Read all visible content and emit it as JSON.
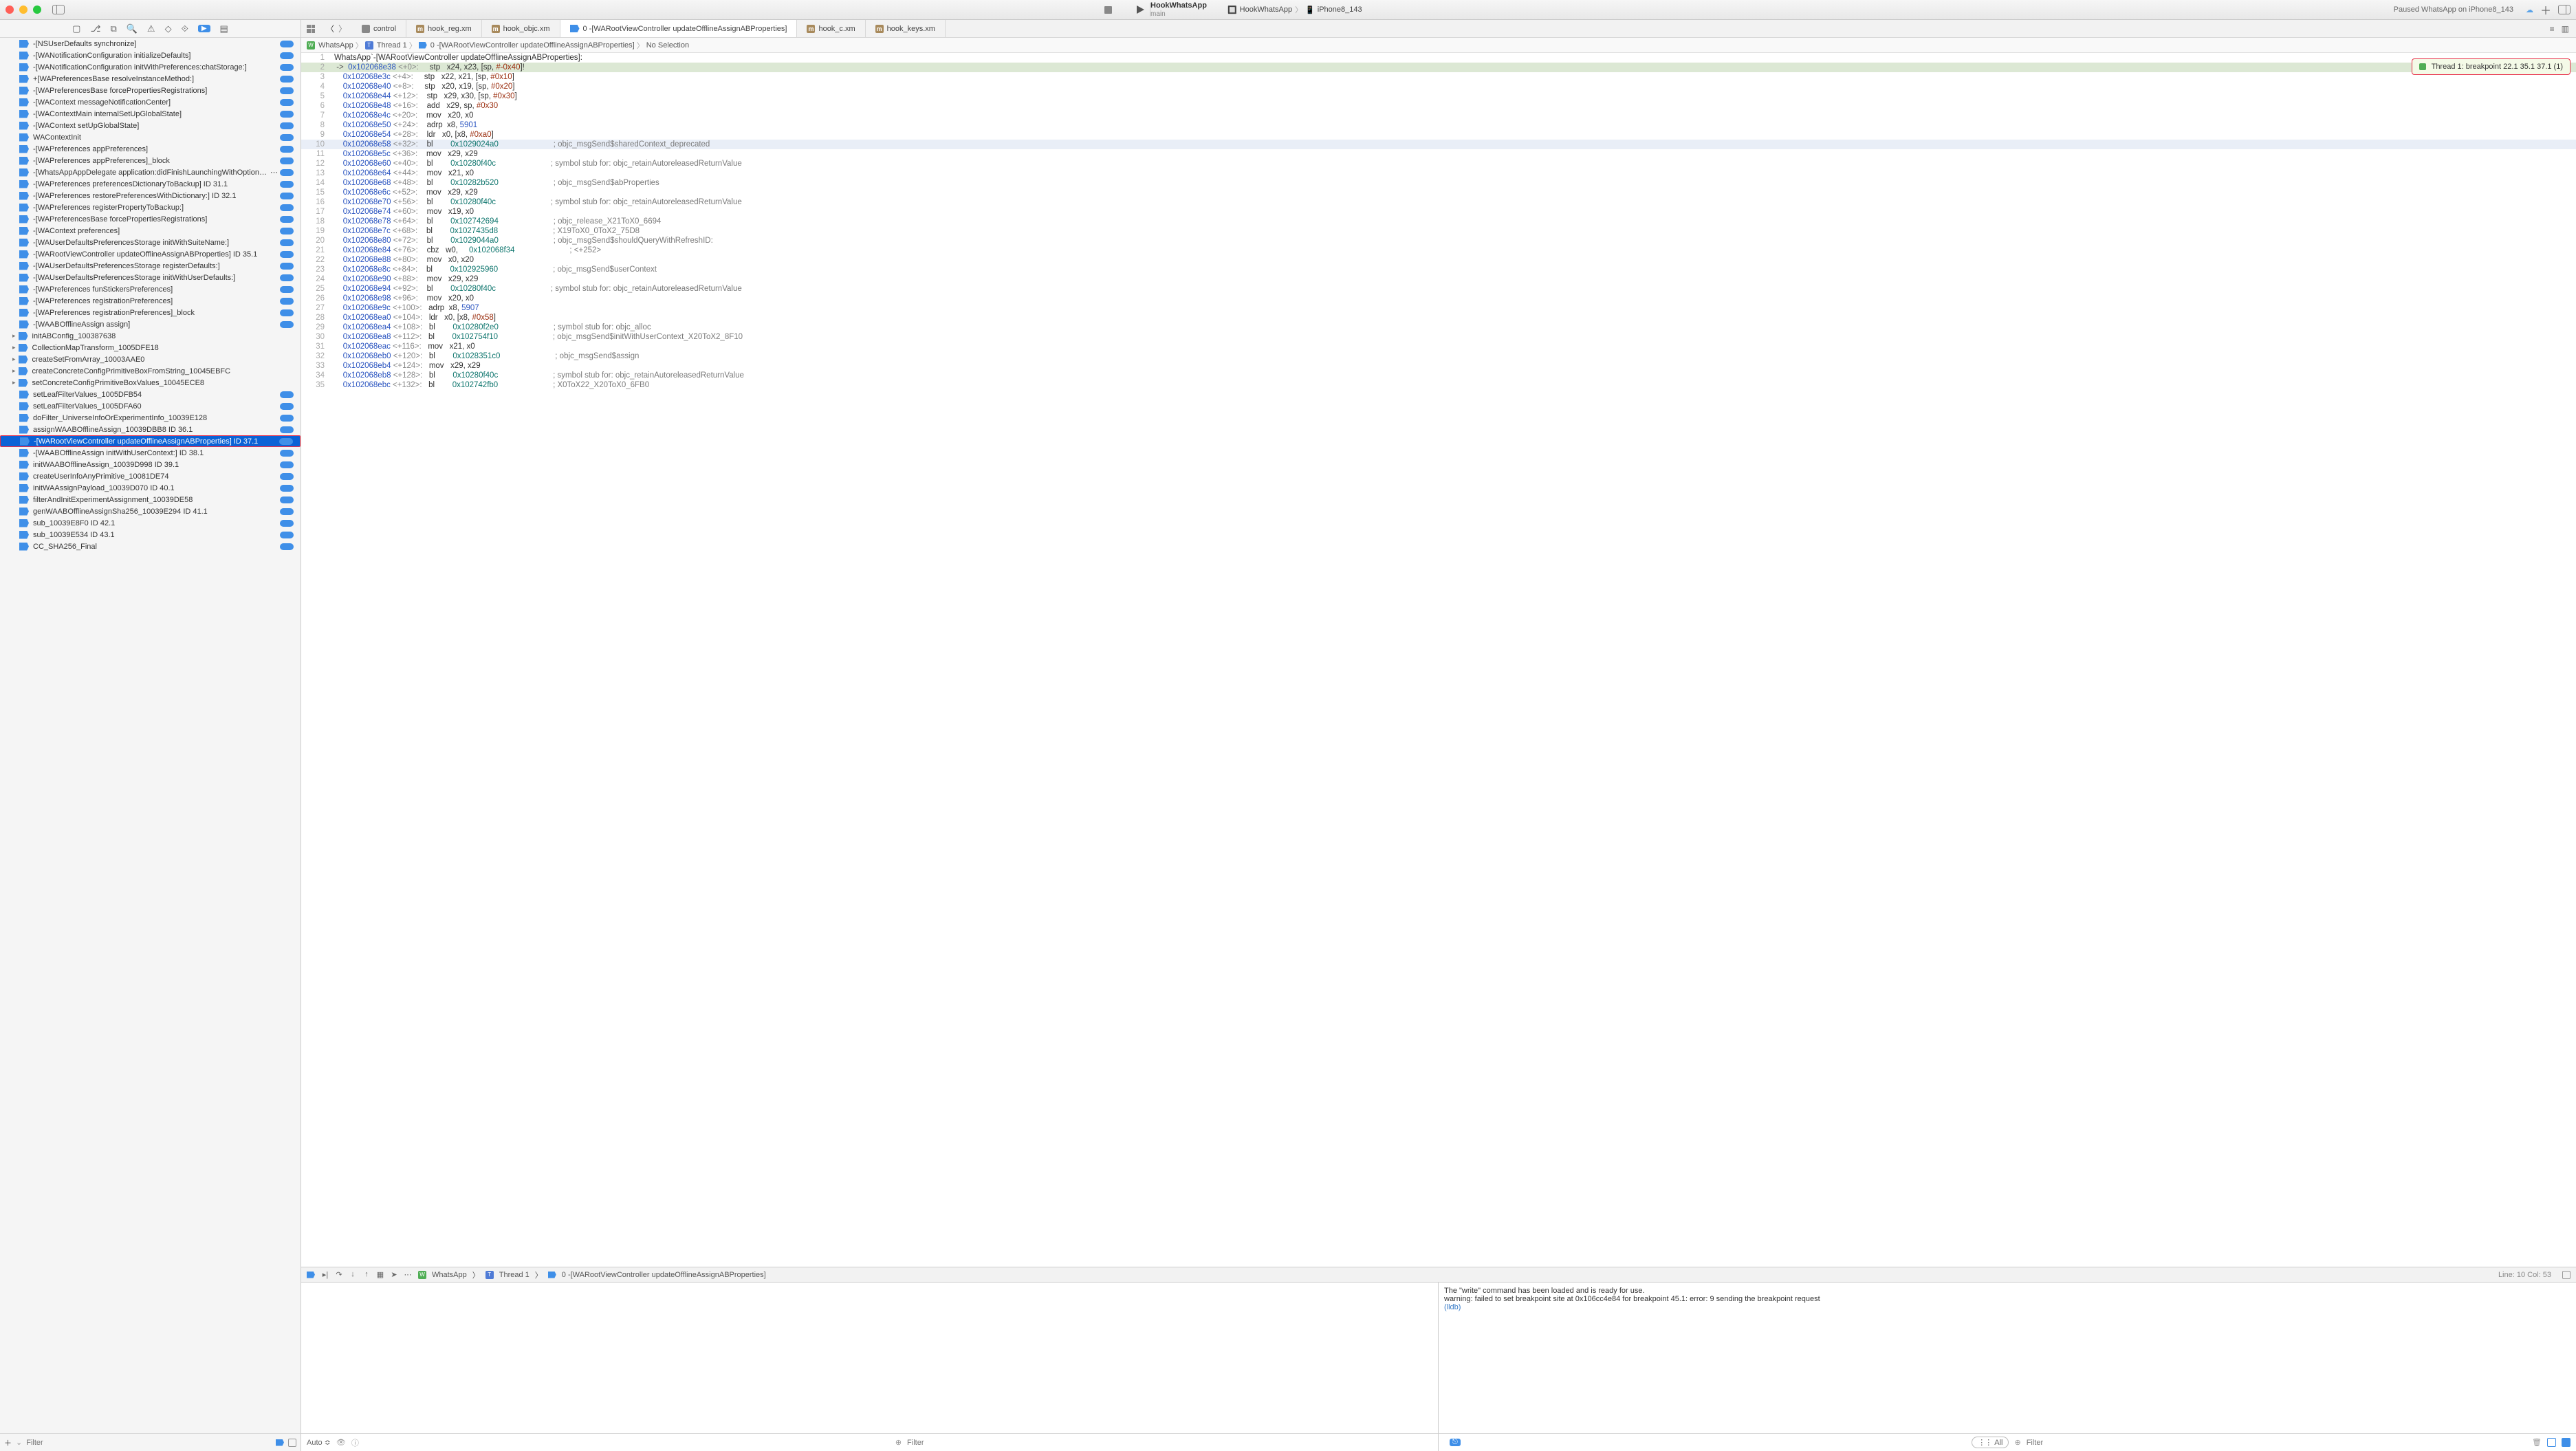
{
  "titlebar": {
    "project": "HookWhatsApp",
    "branch": "main",
    "crumb_app": "HookWhatsApp",
    "crumb_device": "iPhone8_143",
    "status": "Paused WhatsApp on iPhone8_143"
  },
  "nav": {
    "tabs": [
      {
        "icon": "a",
        "label": "control"
      },
      {
        "icon": "m",
        "label": "hook_reg.xm"
      },
      {
        "icon": "m",
        "label": "hook_objc.xm"
      },
      {
        "icon": "bp",
        "label": "0 -[WARootViewController updateOfflineAssignABProperties]",
        "active": true
      },
      {
        "icon": "m",
        "label": "hook_c.xm"
      },
      {
        "icon": "m",
        "label": "hook_keys.xm"
      }
    ]
  },
  "jumpbar": {
    "app": "WhatsApp",
    "thread": "Thread 1",
    "frame": "0 -[WARootViewController updateOfflineAssignABProperties]",
    "sel": "No Selection"
  },
  "overlay": {
    "text": "Thread 1: breakpoint 22.1 35.1 37.1 (1)"
  },
  "code": {
    "header": "WhatsApp`-[WARootViewController updateOfflineAssignABProperties]:",
    "lines": [
      {
        "n": 2,
        "hl": true,
        "arrow": "->",
        "addr": "0x102068e38",
        "off": "<+0>:",
        "op": "stp",
        "args": "x24, x23, [sp, ",
        "hex": "#-0x40",
        "tail": "]!"
      },
      {
        "n": 3,
        "addr": "0x102068e3c",
        "off": "<+4>:",
        "op": "stp",
        "args": "x22, x21, [sp, ",
        "hex": "#0x10",
        "tail": "]"
      },
      {
        "n": 4,
        "addr": "0x102068e40",
        "off": "<+8>:",
        "op": "stp",
        "args": "x20, x19, [sp, ",
        "hex": "#0x20",
        "tail": "]"
      },
      {
        "n": 5,
        "addr": "0x102068e44",
        "off": "<+12>:",
        "op": "stp",
        "args": "x29, x30, [sp, ",
        "hex": "#0x30",
        "tail": "]"
      },
      {
        "n": 6,
        "addr": "0x102068e48",
        "off": "<+16>:",
        "op": "add",
        "args": "x29, sp, ",
        "hex": "#0x30"
      },
      {
        "n": 7,
        "addr": "0x102068e4c",
        "off": "<+20>:",
        "op": "mov",
        "args": "x20, x0"
      },
      {
        "n": 8,
        "addr": "0x102068e50",
        "off": "<+24>:",
        "op": "adrp",
        "args": "x8, ",
        "num": "5901"
      },
      {
        "n": 9,
        "addr": "0x102068e54",
        "off": "<+28>:",
        "op": "ldr",
        "args": "x0, [x8, ",
        "hex": "#0xa0",
        "tail": "]"
      },
      {
        "n": 10,
        "hlrow": true,
        "addr": "0x102068e58",
        "off": "<+32>:",
        "op": "bl",
        "sym": "0x1029024a0",
        "cmt": "; objc_msgSend$sharedContext_deprecated"
      },
      {
        "n": 11,
        "addr": "0x102068e5c",
        "off": "<+36>:",
        "op": "mov",
        "args": "x29, x29"
      },
      {
        "n": 12,
        "addr": "0x102068e60",
        "off": "<+40>:",
        "op": "bl",
        "sym": "0x10280f40c",
        "cmt": "; symbol stub for: objc_retainAutoreleasedReturnValue"
      },
      {
        "n": 13,
        "addr": "0x102068e64",
        "off": "<+44>:",
        "op": "mov",
        "args": "x21, x0"
      },
      {
        "n": 14,
        "addr": "0x102068e68",
        "off": "<+48>:",
        "op": "bl",
        "sym": "0x10282b520",
        "cmt": "; objc_msgSend$abProperties"
      },
      {
        "n": 15,
        "addr": "0x102068e6c",
        "off": "<+52>:",
        "op": "mov",
        "args": "x29, x29"
      },
      {
        "n": 16,
        "addr": "0x102068e70",
        "off": "<+56>:",
        "op": "bl",
        "sym": "0x10280f40c",
        "cmt": "; symbol stub for: objc_retainAutoreleasedReturnValue"
      },
      {
        "n": 17,
        "addr": "0x102068e74",
        "off": "<+60>:",
        "op": "mov",
        "args": "x19, x0"
      },
      {
        "n": 18,
        "addr": "0x102068e78",
        "off": "<+64>:",
        "op": "bl",
        "sym": "0x102742694",
        "cmt": "; objc_release_X21ToX0_6694"
      },
      {
        "n": 19,
        "addr": "0x102068e7c",
        "off": "<+68>:",
        "op": "bl",
        "sym": "0x1027435d8",
        "cmt": "; X19ToX0_0ToX2_75D8"
      },
      {
        "n": 20,
        "addr": "0x102068e80",
        "off": "<+72>:",
        "op": "bl",
        "sym": "0x1029044a0",
        "cmt": "; objc_msgSend$shouldQueryWithRefreshID:"
      },
      {
        "n": 21,
        "addr": "0x102068e84",
        "off": "<+76>:",
        "op": "cbz",
        "args": "w0, ",
        "sym": "0x102068f34",
        "cmt": "; <+252>"
      },
      {
        "n": 22,
        "addr": "0x102068e88",
        "off": "<+80>:",
        "op": "mov",
        "args": "x0, x20"
      },
      {
        "n": 23,
        "addr": "0x102068e8c",
        "off": "<+84>:",
        "op": "bl",
        "sym": "0x102925960",
        "cmt": "; objc_msgSend$userContext"
      },
      {
        "n": 24,
        "addr": "0x102068e90",
        "off": "<+88>:",
        "op": "mov",
        "args": "x29, x29"
      },
      {
        "n": 25,
        "addr": "0x102068e94",
        "off": "<+92>:",
        "op": "bl",
        "sym": "0x10280f40c",
        "cmt": "; symbol stub for: objc_retainAutoreleasedReturnValue"
      },
      {
        "n": 26,
        "addr": "0x102068e98",
        "off": "<+96>:",
        "op": "mov",
        "args": "x20, x0"
      },
      {
        "n": 27,
        "addr": "0x102068e9c",
        "off": "<+100>:",
        "op": "adrp",
        "args": "x8, ",
        "num": "5907"
      },
      {
        "n": 28,
        "addr": "0x102068ea0",
        "off": "<+104>:",
        "op": "ldr",
        "args": "x0, [x8, ",
        "hex": "#0x58",
        "tail": "]"
      },
      {
        "n": 29,
        "addr": "0x102068ea4",
        "off": "<+108>:",
        "op": "bl",
        "sym": "0x10280f2e0",
        "cmt": "; symbol stub for: objc_alloc"
      },
      {
        "n": 30,
        "addr": "0x102068ea8",
        "off": "<+112>:",
        "op": "bl",
        "sym": "0x102754f10",
        "cmt": "; objc_msgSend$initWithUserContext_X20ToX2_8F10"
      },
      {
        "n": 31,
        "addr": "0x102068eac",
        "off": "<+116>:",
        "op": "mov",
        "args": "x21, x0"
      },
      {
        "n": 32,
        "addr": "0x102068eb0",
        "off": "<+120>:",
        "op": "bl",
        "sym": "0x1028351c0",
        "cmt": "; objc_msgSend$assign"
      },
      {
        "n": 33,
        "addr": "0x102068eb4",
        "off": "<+124>:",
        "op": "mov",
        "args": "x29, x29"
      },
      {
        "n": 34,
        "addr": "0x102068eb8",
        "off": "<+128>:",
        "op": "bl",
        "sym": "0x10280f40c",
        "cmt": "; symbol stub for: objc_retainAutoreleasedReturnValue"
      },
      {
        "n": 35,
        "addr": "0x102068ebc",
        "off": "<+132>:",
        "op": "bl",
        "sym": "0x102742fb0",
        "cmt": "; X0ToX22_X20ToX0_6FB0"
      }
    ]
  },
  "debugbar": {
    "app": "WhatsApp",
    "thread": "Thread 1",
    "frame": "0 -[WARootViewController updateOfflineAssignABProperties]",
    "linecol": "Line: 10  Col: 53"
  },
  "console": {
    "line1": "The \"write\" command has been loaded and is ready for use.",
    "line2": "warning: failed to set breakpoint site at 0x106cc4e84 for breakpoint 45.1: error: 9 sending the breakpoint request",
    "prompt": "(lldb)"
  },
  "botfoot": {
    "auto": "Auto ≎",
    "filter": "Filter",
    "all": "All"
  },
  "leftfoot": {
    "filter": "Filter"
  },
  "bp_items": [
    {
      "label": "-[NSUserDefaults synchronize]",
      "trail": true
    },
    {
      "label": "-[WANotificationConfiguration initializeDefaults]",
      "trail": true
    },
    {
      "label": "-[WANotificationConfiguration initWithPreferences:chatStorage:]",
      "trail": true
    },
    {
      "label": "+[WAPreferencesBase resolveInstanceMethod:]",
      "trail": true
    },
    {
      "label": "-[WAPreferencesBase forcePropertiesRegistrations]",
      "trail": true
    },
    {
      "label": "-[WAContext messageNotificationCenter]",
      "trail": true
    },
    {
      "label": "-[WAContextMain internalSetUpGlobalState]",
      "trail": true
    },
    {
      "label": "-[WAContext setUpGlobalState]",
      "trail": true
    },
    {
      "label": "WAContextInit",
      "trail": true
    },
    {
      "label": "-[WAPreferences appPreferences]",
      "trail": true
    },
    {
      "label": "-[WAPreferences appPreferences]_block",
      "trail": true
    },
    {
      "label": "-[WhatsAppAppDelegate application:didFinishLaunchingWithOptions:]  I…",
      "trail": true,
      "dots": true
    },
    {
      "label": "-[WAPreferences preferencesDictionaryToBackup]  ID 31.1",
      "trail": true
    },
    {
      "label": "-[WAPreferences restorePreferencesWithDictionary:]  ID 32.1",
      "trail": true
    },
    {
      "label": "-[WAPreferences registerPropertyToBackup:]",
      "trail": true
    },
    {
      "label": "-[WAPreferencesBase forcePropertiesRegistrations]",
      "trail": true
    },
    {
      "label": "-[WAContext preferences]",
      "trail": true
    },
    {
      "label": "-[WAUserDefaultsPreferencesStorage initWithSuiteName:]",
      "trail": true
    },
    {
      "label": "-[WARootViewController updateOfflineAssignABProperties]  ID 35.1",
      "trail": true
    },
    {
      "label": "-[WAUserDefaultsPreferencesStorage registerDefaults:]",
      "trail": true
    },
    {
      "label": "-[WAUserDefaultsPreferencesStorage initWithUserDefaults:]",
      "trail": true
    },
    {
      "label": "-[WAPreferences funStickersPreferences]",
      "trail": true
    },
    {
      "label": "-[WAPreferences registrationPreferences]",
      "trail": true
    },
    {
      "label": "-[WAPreferences registrationPreferences]_block",
      "trail": true
    },
    {
      "label": "-[WAABOfflineAssign assign]",
      "trail": true
    },
    {
      "label": "initABConfig_100387638",
      "disc": true
    },
    {
      "label": "CollectionMapTransform_1005DFE18",
      "disc": true
    },
    {
      "label": "createSetFromArray_10003AAE0",
      "disc": true
    },
    {
      "label": "createConcreteConfigPrimitiveBoxFromString_10045EBFC",
      "disc": true
    },
    {
      "label": "setConcreteConfigPrimitiveBoxValues_10045ECE8",
      "disc": true
    },
    {
      "label": "setLeafFilterValues_1005DFB54",
      "trail": true
    },
    {
      "label": "setLeafFilterValues_1005DFA60",
      "trail": true
    },
    {
      "label": "doFilter_UniverseInfoOrExperimentInfo_10039E128",
      "trail": true
    },
    {
      "label": "assignWAABOfflineAssign_10039DBB8  ID 36.1",
      "trail": true
    },
    {
      "label": "-[WARootViewController updateOfflineAssignABProperties]  ID 37.1",
      "trail": true,
      "sel": true
    },
    {
      "label": "-[WAABOfflineAssign initWithUserContext:]  ID 38.1",
      "trail": true
    },
    {
      "label": "initWAABOfflineAssign_10039D998  ID 39.1",
      "trail": true
    },
    {
      "label": "createUserInfoAnyPrimitive_10081DE74",
      "trail": true
    },
    {
      "label": "initWAAssignPayload_10039D070  ID 40.1",
      "trail": true
    },
    {
      "label": "filterAndInitExperimentAssignment_10039DE58",
      "trail": true
    },
    {
      "label": "genWAABOfflineAssignSha256_10039E294  ID 41.1",
      "trail": true
    },
    {
      "label": "sub_10039E8F0  ID 42.1",
      "trail": true
    },
    {
      "label": "sub_10039E534  ID 43.1",
      "trail": true
    },
    {
      "label": "CC_SHA256_Final",
      "trail": true
    }
  ]
}
